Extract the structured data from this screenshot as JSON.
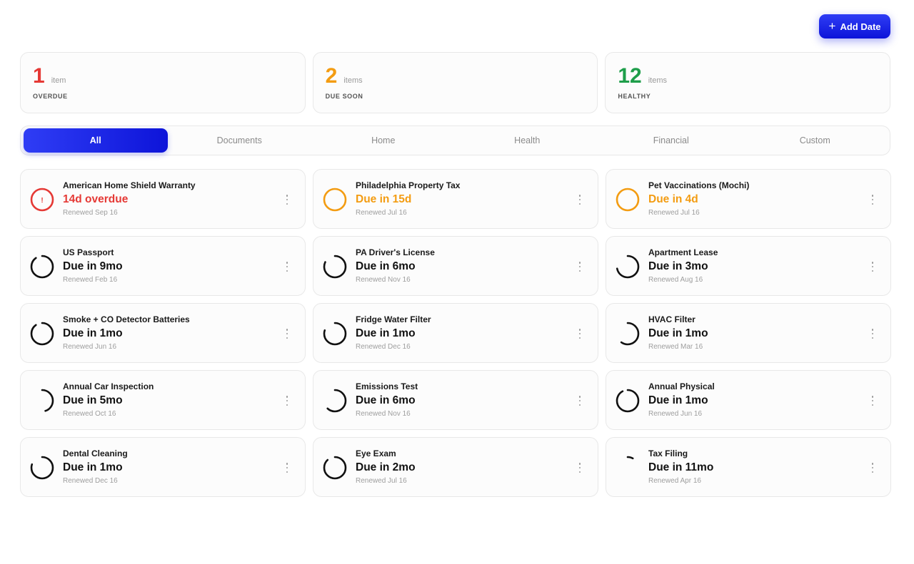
{
  "header": {
    "add_label": "Add Date"
  },
  "colors": {
    "overdue": "#e53935",
    "soon": "#f39c12",
    "healthy": "#1e9e4a",
    "accent": "#1a24e8",
    "ring": "#111111"
  },
  "stats": [
    {
      "num": "1",
      "unit": "item",
      "label": "OVERDUE",
      "status": "overdue"
    },
    {
      "num": "2",
      "unit": "items",
      "label": "DUE SOON",
      "status": "soon"
    },
    {
      "num": "12",
      "unit": "items",
      "label": "HEALTHY",
      "status": "healthy"
    }
  ],
  "tabs": [
    "All",
    "Documents",
    "Home",
    "Health",
    "Financial",
    "Custom"
  ],
  "active_tab": "All",
  "items": [
    {
      "title": "American Home Shield Warranty",
      "due": "14d overdue",
      "renewed": "Renewed Sep 16",
      "status": "overdue",
      "remaining": 1.0
    },
    {
      "title": "Philadelphia Property Tax",
      "due": "Due in 15d",
      "renewed": "Renewed Jul 16",
      "status": "soon",
      "remaining": 1.0
    },
    {
      "title": "Pet Vaccinations (Mochi)",
      "due": "Due in 4d",
      "renewed": "Renewed Jul 16",
      "status": "soon",
      "remaining": 1.0
    },
    {
      "title": "US Passport",
      "due": "Due in 9mo",
      "renewed": "Renewed Feb 16",
      "status": "healthy",
      "remaining": 0.9
    },
    {
      "title": "PA Driver's License",
      "due": "Due in 6mo",
      "renewed": "Renewed Nov 16",
      "status": "healthy",
      "remaining": 0.82
    },
    {
      "title": "Apartment Lease",
      "due": "Due in 3mo",
      "renewed": "Renewed Aug 16",
      "status": "healthy",
      "remaining": 0.72
    },
    {
      "title": "Smoke + CO Detector Batteries",
      "due": "Due in 1mo",
      "renewed": "Renewed Jun 16",
      "status": "healthy",
      "remaining": 0.9
    },
    {
      "title": "Fridge Water Filter",
      "due": "Due in 1mo",
      "renewed": "Renewed Dec 16",
      "status": "healthy",
      "remaining": 0.8
    },
    {
      "title": "HVAC Filter",
      "due": "Due in 1mo",
      "renewed": "Renewed Mar 16",
      "status": "healthy",
      "remaining": 0.6
    },
    {
      "title": "Annual Car Inspection",
      "due": "Due in 5mo",
      "renewed": "Renewed Oct 16",
      "status": "healthy",
      "remaining": 0.45
    },
    {
      "title": "Emissions Test",
      "due": "Due in 6mo",
      "renewed": "Renewed Nov 16",
      "status": "healthy",
      "remaining": 0.62
    },
    {
      "title": "Annual Physical",
      "due": "Due in 1mo",
      "renewed": "Renewed Jun 16",
      "status": "healthy",
      "remaining": 0.92
    },
    {
      "title": "Dental Cleaning",
      "due": "Due in 1mo",
      "renewed": "Renewed Dec 16",
      "status": "healthy",
      "remaining": 0.8
    },
    {
      "title": "Eye Exam",
      "due": "Due in 2mo",
      "renewed": "Renewed Jul 16",
      "status": "healthy",
      "remaining": 0.88
    },
    {
      "title": "Tax Filing",
      "due": "Due in 11mo",
      "renewed": "Renewed Apr 16",
      "status": "healthy",
      "remaining": 0.08
    }
  ]
}
